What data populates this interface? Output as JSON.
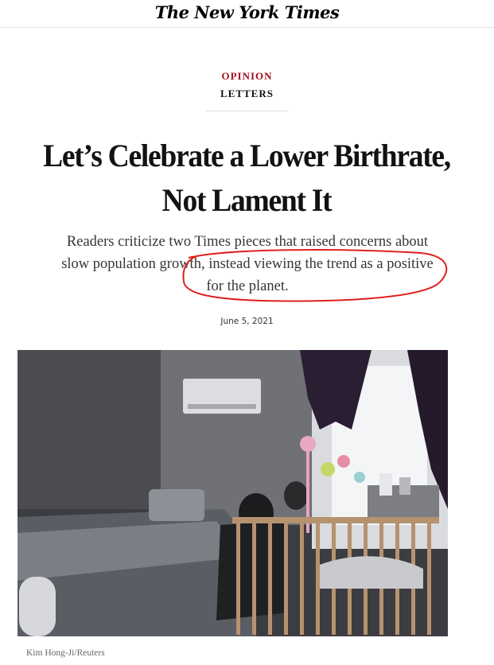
{
  "masthead": {
    "logo_text": "The New York Times"
  },
  "article": {
    "section": "OPINION",
    "subsection": "LETTERS",
    "headline": "Let’s Celebrate a Lower Birthrate, Not Lament It",
    "summary_line1": "Readers criticize two Times pieces that raised concerns about",
    "summary_line2_before": "slow population growth,",
    "summary_line2_after": " instead viewing the trend as a positive",
    "summary_line3": "for the planet.",
    "date": "June 5, 2021"
  },
  "image": {
    "credit": "Kim Hong-Ji/Reuters"
  },
  "colors": {
    "kicker_red": "#a4111e",
    "annotation_red": "#e0201c"
  }
}
